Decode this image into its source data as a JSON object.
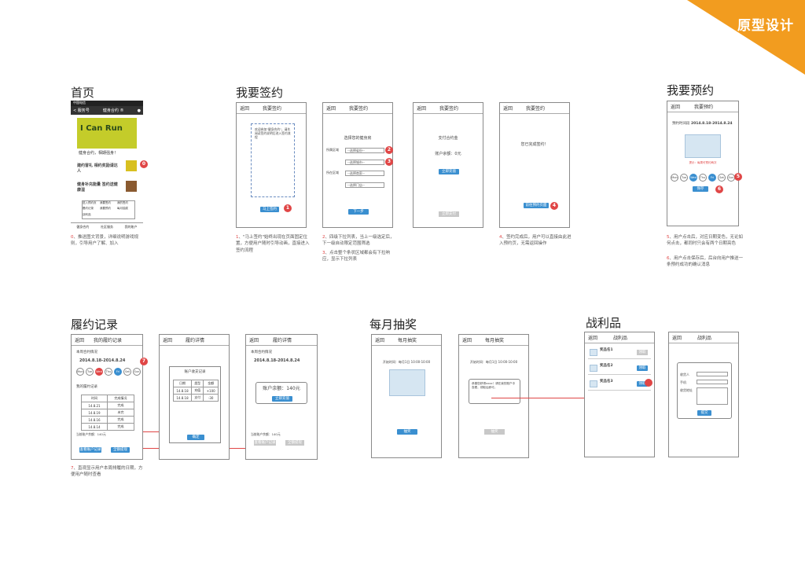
{
  "corner_title": "原型设计",
  "sections": {
    "home": "首页",
    "sign": "我要签约",
    "reserve": "我要预约",
    "record": "履约记录",
    "lottery": "每月抽奖",
    "trophy": "战利品"
  },
  "home": {
    "status": "中国电信",
    "nav_back": "< 服务号",
    "nav_title": "健身合约 ®",
    "banner_text": "健身合约，相期强身！",
    "item1": "建约冒礼 相约奖励请达人",
    "item2": "健身补充能量 签约送健康湿",
    "menu": [
      "进入预约页",
      "我要签约",
      "我的签约",
      "履约记录",
      "我要预约",
      "每月抽奖",
      "战利品"
    ],
    "tabs": [
      "健身合约",
      "社区服务",
      "我的账户"
    ]
  },
  "captions": {
    "c0_num": "0",
    "c0": "、推送图文背景，详细说明游戏规则，引导用户了解、加入",
    "c1_num": "1",
    "c1": "、\"马上签约\"始终出现在页面固定位置，方便用户随时引导动画，直接进入签约流程",
    "c2_num": "2",
    "c2": "、四级下拉列表，当上一级选定后，下一级自动限定范围筛选",
    "c3_num": "3",
    "c3": "、点击整个条状区域都会有下拉响应，显示下拉列表",
    "c4_num": "4",
    "c4": "、签约完成后，用户可以直接由此进入预约页，无需返回操作",
    "c5_num": "5",
    "c5": "、用户点击后，对应日期变色，无论如何点击，都同时只会有两个日期亮色",
    "c6_num": "6",
    "c6": "、用户点击保存后，后台向用户推送一条预约成功的确认消息",
    "c7_num": "7",
    "c7": "、直观显示用户本周排履的日期，方便用户随时查看"
  },
  "sign": {
    "back": "返回",
    "title": "我要签约",
    "intro": "欢迎参加\"健身合约\"，请先阅读签约说明后进入签约流程",
    "btn_sign": "马上签约",
    "select_title": "选择您的健身房",
    "labels": [
      "所属区域",
      "所在区域"
    ],
    "selects": [
      "--选择省份--",
      "--选择城市--",
      "--选择商家--",
      "--选择门店--"
    ],
    "next": "下一步",
    "pay_title": "支付合约金",
    "balance": "账户余额：0元",
    "btn_recharge": "立即充值",
    "btn_pay": "立即支付",
    "done": "您已完成签约！",
    "btn_reserve": "前往预约页面"
  },
  "reserve": {
    "back": "返回",
    "title": "我要预约",
    "period_label": "预约时间段",
    "period": "2014.8.18-2014.8.24",
    "note": "提示：每周可预约两次",
    "days": [
      "Mon",
      "Tue",
      "Wed",
      "Thu",
      "Fri",
      "Sat",
      "Sun"
    ],
    "btn_save": "保存"
  },
  "record": {
    "back": "返回",
    "title1": "我的履约记录",
    "title2": "履约详情",
    "week_label": "本周合约情况",
    "period": "2014.8.18-2014.8.24",
    "days": [
      "Mon",
      "Tue",
      "Wed",
      "Thu",
      "Fri",
      "Sat",
      "Sun"
    ],
    "hist_label": "我的履约记录",
    "cols": [
      "时间",
      "完成情况"
    ],
    "rows": [
      [
        "14.8.21",
        "完成"
      ],
      [
        "14.8.19",
        "未完"
      ],
      [
        "14.8.16",
        "完成"
      ],
      [
        "14.8.14",
        "完成"
      ]
    ],
    "acct_cols": [
      "日期",
      "类型",
      "金额"
    ],
    "acct_rows": [
      [
        "14.8.18",
        "充值",
        "+100"
      ],
      [
        "14.8.18",
        "支付",
        "-30"
      ]
    ],
    "acct_title": "账户收支记录",
    "balance_label": "账户余额：140元",
    "btn_recharge": "立即充值",
    "btn_record": "查看账户记录",
    "btn_withdraw": "全额提现",
    "btn_close": "确定",
    "detail_link": "点击查看账户记录",
    "balance_small": "当前账户余额：140元"
  },
  "lottery": {
    "back": "返回",
    "title": "每月抽奖",
    "time": "开始时间：每月1日 10:00-10:00",
    "btn": "抽奖",
    "result": "恭喜您获得xxxx！请在我的账户中查看，领取后即可。"
  },
  "trophy": {
    "back": "返回",
    "title": "战利品",
    "items": [
      {
        "name": "奖品名1",
        "btn": "领取"
      },
      {
        "name": "奖品名2",
        "btn": "领取"
      },
      {
        "name": "奖品名3",
        "btn": "领取"
      }
    ],
    "form_fields": [
      "收货人",
      "手机",
      "收货地址"
    ],
    "btn_submit": "提交"
  }
}
